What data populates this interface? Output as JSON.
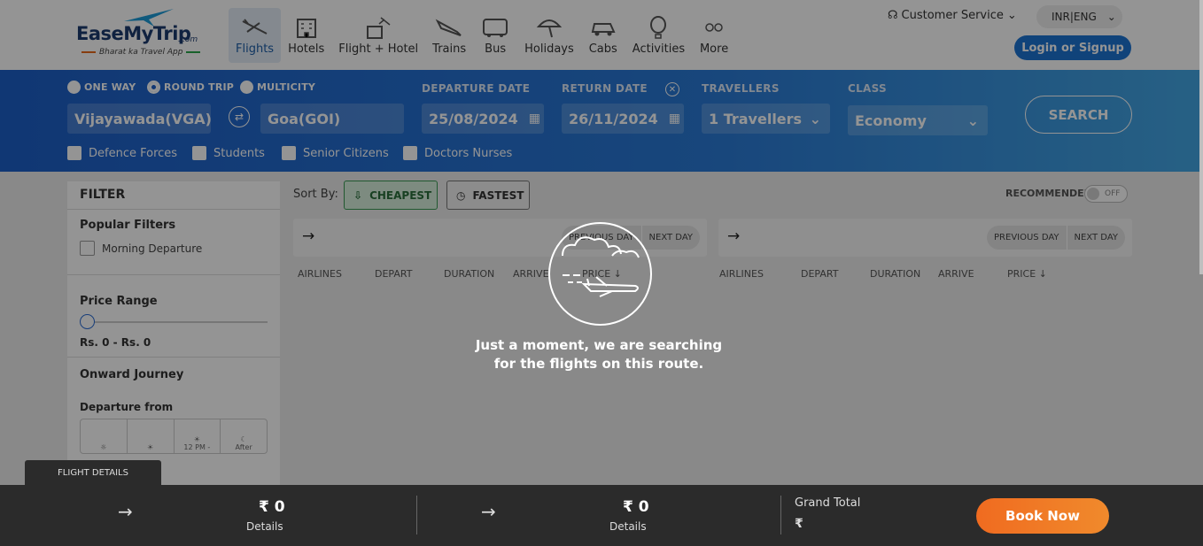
{
  "header": {
    "brand": "EaseMyTrip",
    "brand_suffix": ".com",
    "tagline": "Bharat ka Travel App",
    "nav": [
      {
        "label": "Flights",
        "icon": "plane-icon"
      },
      {
        "label": "Hotels",
        "icon": "hotel-icon"
      },
      {
        "label": "Flight + Hotel",
        "icon": "flight-hotel-icon"
      },
      {
        "label": "Trains",
        "icon": "train-icon"
      },
      {
        "label": "Bus",
        "icon": "bus-icon"
      },
      {
        "label": "Holidays",
        "icon": "umbrella-icon"
      },
      {
        "label": "Cabs",
        "icon": "car-icon"
      },
      {
        "label": "Activities",
        "icon": "balloon-icon"
      },
      {
        "label": "More",
        "icon": "more-icon"
      }
    ],
    "customer_service": "Customer Service",
    "currency_lang": "INR|ENG",
    "login": "Login or Signup"
  },
  "search": {
    "trip_types": [
      "ONE WAY",
      "ROUND TRIP",
      "MULTICITY"
    ],
    "selected_trip": "ROUND TRIP",
    "from": "Vijayawada(VGA)",
    "to": "Goa(GOI)",
    "departure_label": "DEPARTURE DATE",
    "departure_value": "25/08/2024",
    "return_label": "RETURN DATE",
    "return_value": "26/11/2024",
    "travellers_label": "TRAVELLERS",
    "travellers_value": "1 Travellers",
    "class_label": "CLASS",
    "class_value": "Economy",
    "search_button": "SEARCH",
    "fare_types": [
      "Defence Forces",
      "Students",
      "Senior Citizens",
      "Doctors Nurses"
    ]
  },
  "filter": {
    "title": "FILTER",
    "popular_title": "Popular Filters",
    "popular_options": [
      "Morning Departure"
    ],
    "price_title": "Price Range",
    "price_value": "Rs. 0 - Rs. 0",
    "onward_title": "Onward Journey",
    "departure_from": "Departure from",
    "time_slots": [
      "",
      "",
      "12 PM -",
      "After"
    ]
  },
  "results": {
    "sort_by": "Sort By:",
    "cheapest": "CHEAPEST",
    "fastest": "FASTEST",
    "recommended": "RECOMMENDED",
    "toggle_state": "OFF",
    "route_arrow": "→",
    "previous_day": "PREVIOUS DAY",
    "next_day": "NEXT DAY",
    "columns": [
      "AIRLINES",
      "DEPART",
      "DURATION",
      "ARRIVE",
      "PRICE ↓"
    ]
  },
  "loading": {
    "line1": "Just a moment, we are searching",
    "line2": "for the flights on this route."
  },
  "bottom_bar": {
    "tab": "FLIGHT DETAILS",
    "onward_price": "₹ 0",
    "return_price": "₹ 0",
    "details": "Details",
    "grand_total_label": "Grand Total",
    "grand_total_symbol": "₹",
    "book_now": "Book Now"
  },
  "colors": {
    "search_bar_start": "#1d5fc8",
    "search_bar_end": "#44a7e4",
    "login_blue": "#1d74d3",
    "book_orange": "#f06b20",
    "cheapest_green": "#3a9a54",
    "bottom_bar": "#2b2b2b"
  }
}
